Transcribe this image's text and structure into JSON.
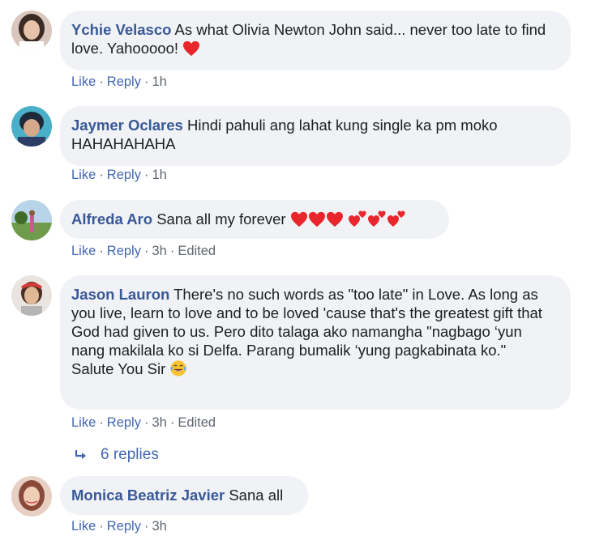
{
  "comments": [
    {
      "author": "Ychie Velasco",
      "text": "As what Olivia Newton John said... never too late to find love. Yahooooo!",
      "emoji": [
        "red-heart"
      ],
      "actions": {
        "like": "Like",
        "reply": "Reply",
        "time": "1h"
      }
    },
    {
      "author": "Jaymer Oclares",
      "text": "Hindi pahuli ang lahat kung single ka pm moko HAHAHAHAHA",
      "actions": {
        "like": "Like",
        "reply": "Reply",
        "time": "1h"
      }
    },
    {
      "author": "Alfreda Aro",
      "text": "Sana all my forever",
      "emoji": [
        "red-heart",
        "red-heart",
        "red-heart",
        "two-hearts",
        "two-hearts",
        "two-hearts"
      ],
      "actions": {
        "like": "Like",
        "reply": "Reply",
        "time": "3h",
        "edited": "Edited"
      }
    },
    {
      "author": "Jason Lauron",
      "text": "There's no such words as \"too late\" in Love. As long as you live, learn to love and to be loved 'cause that's the greatest gift that God had given to us. Pero dito talaga ako namangha \"nagbago ‘yun nang makilala ko si Delfa. Parang bumalik ‘yung pagkabinata ko.\"",
      "text2": "Salute You Sir",
      "emoji": [
        "tears-of-joy"
      ],
      "actions": {
        "like": "Like",
        "reply": "Reply",
        "time": "3h",
        "edited": "Edited"
      }
    },
    {
      "author": "Monica Beatriz Javier",
      "text": "Sana all",
      "actions": {
        "like": "Like",
        "reply": "Reply",
        "time": "3h"
      }
    }
  ],
  "replies_link": "6 replies",
  "colors": {
    "name": "#385898",
    "link": "#4267b2",
    "bubble": "#f0f2f5",
    "meta": "#606770"
  }
}
